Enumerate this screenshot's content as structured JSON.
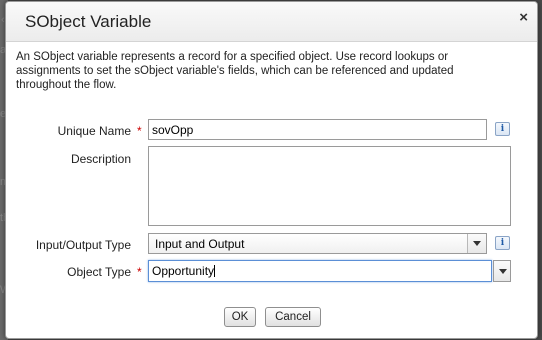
{
  "background": {
    "fragments": [
      "‹",
      "al",
      "e",
      "m",
      "th",
      "W"
    ]
  },
  "dialog": {
    "title": "SObject Variable",
    "close_glyph": "×",
    "description": "An SObject variable represents a record for a specified object. Use record lookups or assignments to set the sObject variable's fields, which can be referenced and updated throughout the flow."
  },
  "form": {
    "unique_name": {
      "label": "Unique Name",
      "required_marker": "*",
      "value": "sovOpp"
    },
    "description": {
      "label": "Description",
      "value": ""
    },
    "io_type": {
      "label": "Input/Output Type",
      "selected": "Input and Output"
    },
    "object_type": {
      "label": "Object Type",
      "required_marker": "*",
      "value": "Opportunity"
    },
    "info_glyph": "i"
  },
  "buttons": {
    "ok": "OK",
    "cancel": "Cancel"
  }
}
